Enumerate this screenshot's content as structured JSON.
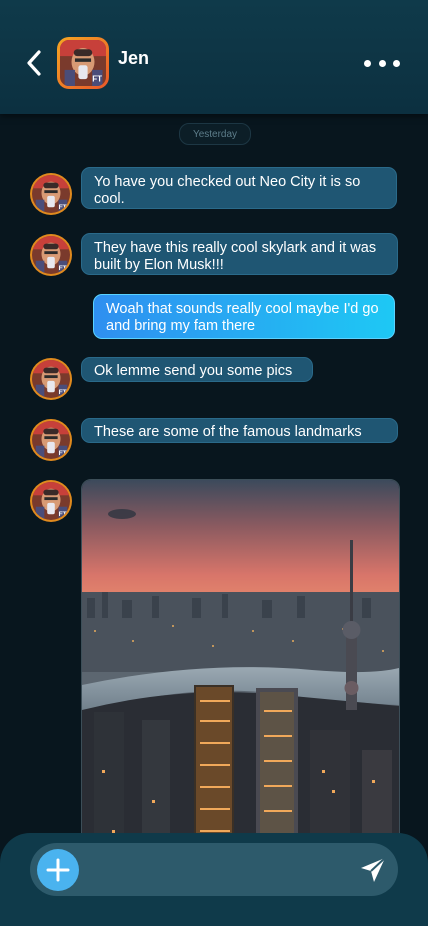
{
  "header": {
    "contact_name": "Jen",
    "back_icon": "chevron-left-icon",
    "more_icon": "more-horizontal-icon"
  },
  "chat": {
    "date_label": "Yesterday",
    "messages": [
      {
        "sender": "Jen",
        "direction": "incoming",
        "text": "Yo have you checked out Neo City it is so cool."
      },
      {
        "sender": "Jen",
        "direction": "incoming",
        "text": "They have this really cool skylark and it was built by Elon Musk!!!"
      },
      {
        "sender": "me",
        "direction": "outgoing",
        "text": "Woah that sounds really cool maybe I'd go and bring my fam there"
      },
      {
        "sender": "Jen",
        "direction": "incoming",
        "text": "Ok lemme send you some pics"
      },
      {
        "sender": "Jen",
        "direction": "incoming",
        "text": "These are some of the famous landmarks"
      },
      {
        "sender": "Jen",
        "direction": "incoming",
        "type": "image",
        "subject": "city skyline at dusk"
      }
    ]
  },
  "composer": {
    "value": "",
    "placeholder": "",
    "add_icon": "plus-icon",
    "send_icon": "send-icon"
  },
  "colors": {
    "header_bg": "#0f3a4a",
    "chat_bg": "#08161e",
    "incoming_bubble": "#1f5673",
    "outgoing_bubble_start": "#2f8ff0",
    "outgoing_bubble_end": "#1ec8f4",
    "add_button": "#4ab3ef"
  }
}
